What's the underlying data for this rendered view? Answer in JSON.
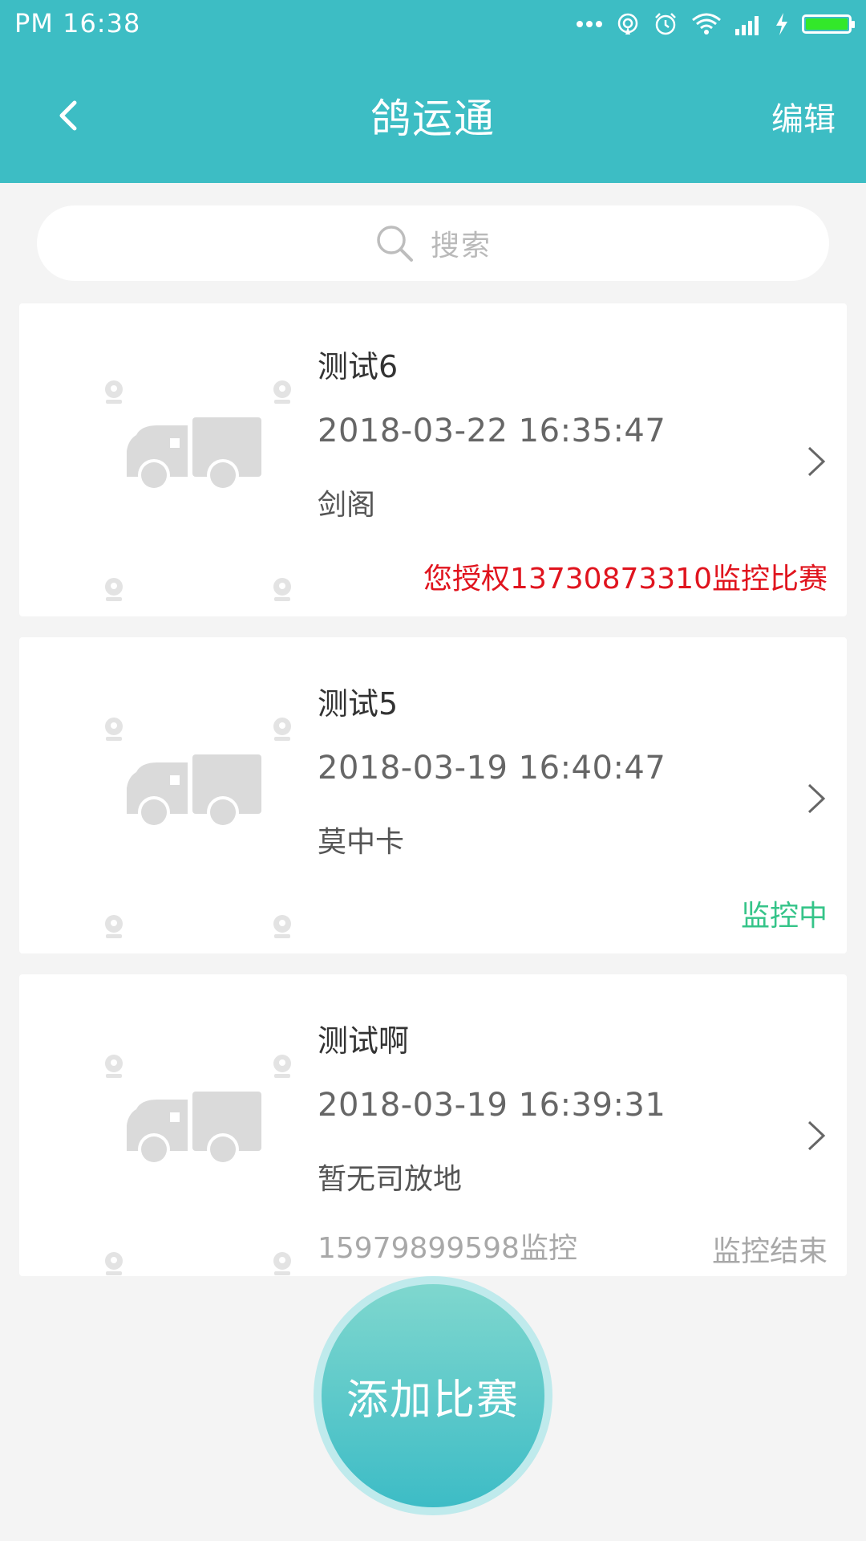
{
  "status_bar": {
    "time": "PM  16:38",
    "battery_color": "#33e82a"
  },
  "header": {
    "title": "鸽运通",
    "edit_label": "编辑",
    "back_icon": "chevron-left-icon",
    "color": "#3dbdc4"
  },
  "search": {
    "placeholder": "搜索",
    "icon": "search-icon"
  },
  "races": [
    {
      "name": "测试6",
      "datetime": "2018-03-22 16:35:47",
      "place": "剑阁",
      "status": "您授权13730873310监控比赛",
      "status_color": "#e0141e"
    },
    {
      "name": "测试5",
      "datetime": "2018-03-19 16:40:47",
      "place": "莫中卡",
      "status": "监控中",
      "status_color": "#35c489"
    },
    {
      "name": "测试啊",
      "datetime": "2018-03-19 16:39:31",
      "place": "暂无司放地",
      "extra": "15979899598监控",
      "status": "监控结束",
      "status_color": "#a8a8a8"
    }
  ],
  "fab": {
    "label": "添加比赛"
  }
}
